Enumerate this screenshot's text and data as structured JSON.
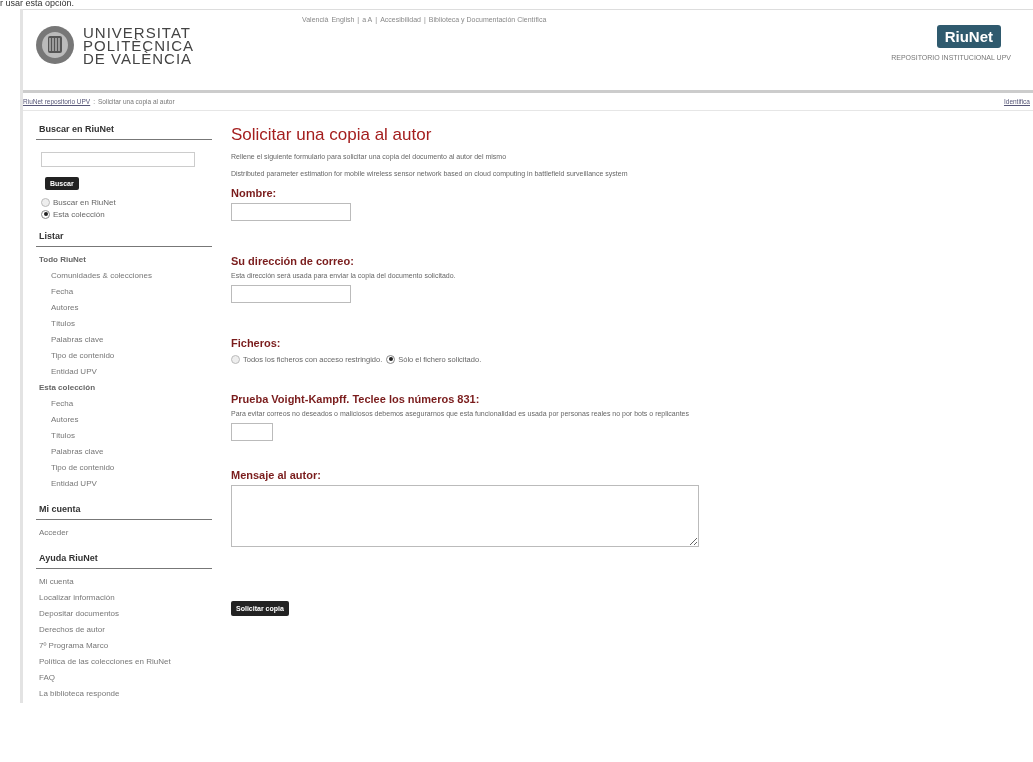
{
  "top_note": "r usar esta opción.",
  "header": {
    "university_name": [
      "UNIVERSITAT",
      "POLITÈCNICA",
      "DE VALÈNCIA"
    ],
    "top_links": [
      {
        "links": [
          "Valencià",
          "English"
        ]
      },
      {
        "links": [
          "a A"
        ]
      },
      {
        "links": [
          "Accesibilidad"
        ]
      },
      {
        "links": [
          "Biblioteca y Documentación Científica"
        ]
      }
    ],
    "separator": "|",
    "logo_text": "RiuNet",
    "tagline": "REPOSITORIO INSTITUCIONAL UPV"
  },
  "breadcrumb": {
    "link": "RiuNet repositorio UPV",
    "separator": ":",
    "current": "Solicitar una copia al autor",
    "login_link": "Identifica"
  },
  "sidebar": {
    "search": {
      "title": "Buscar en RiuNet",
      "button": "Buscar",
      "scopes": [
        {
          "label": "Buscar en RiuNet",
          "selected": false
        },
        {
          "label": "Esta colección",
          "selected": true
        }
      ]
    },
    "sections": [
      {
        "title": "Listar",
        "groups": [
          {
            "label": "Todo RiuNet",
            "children": [
              {
                "label": "Comunidades & colecciones"
              },
              {
                "label": "Fecha"
              },
              {
                "label": "Autores"
              },
              {
                "label": "Títulos"
              },
              {
                "label": "Palabras clave"
              },
              {
                "label": "Tipo de contenido"
              },
              {
                "label": "Entidad UPV"
              }
            ]
          },
          {
            "label": "Esta colección",
            "children": [
              {
                "label": "Fecha"
              },
              {
                "label": "Autores"
              },
              {
                "label": "Títulos"
              },
              {
                "label": "Palabras clave"
              },
              {
                "label": "Tipo de contenido"
              },
              {
                "label": "Entidad UPV"
              }
            ]
          }
        ]
      },
      {
        "title": "Mi cuenta",
        "groups": [
          {
            "label": "Acceder"
          }
        ]
      },
      {
        "title": "Ayuda RiuNet",
        "groups": [
          {
            "label": "Mi cuenta"
          },
          {
            "label": "Localizar información"
          },
          {
            "label": "Depositar documentos"
          },
          {
            "label": "Derechos de autor"
          },
          {
            "label": "7º Programa Marco"
          },
          {
            "label": "Política de las colecciones en RiuNet"
          },
          {
            "label": "FAQ"
          },
          {
            "label": "La biblioteca responde"
          }
        ]
      }
    ]
  },
  "main": {
    "title": "Solicitar una copia al autor",
    "intro": "Rellene el siguiente formulario para solicitar una copia del documento al autor del mismo",
    "document_title": "Distributed parameter estimation for mobile wireless sensor network based on cloud computing in battlefield surveillance system",
    "fields": [
      {
        "kind": "text",
        "label": "Nombre:"
      },
      {
        "kind": "text",
        "label": "Su dirección de correo:",
        "help": "Esta dirección será usada para enviar la copia del documento solicitado."
      },
      {
        "kind": "radio",
        "label": "Ficheros:",
        "options": [
          {
            "label": "Todos los ficheros con acceso restringido.",
            "selected": false
          },
          {
            "label": "Sólo el fichero solicitado.",
            "selected": true
          }
        ]
      },
      {
        "kind": "short",
        "label": "Prueba Voight-Kampff. Teclee los números 831:",
        "help": "Para evitar correos no deseados o maliciosos debemos asegurarnos que esta funcionalidad es usada por personas reales no por bots o replicantes"
      },
      {
        "kind": "textarea",
        "label": "Mensaje al autor:"
      }
    ],
    "submit": "Solicitar copia"
  }
}
